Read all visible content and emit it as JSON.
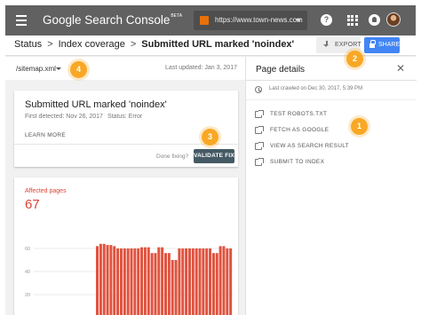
{
  "app": {
    "title": "Google Search Console",
    "badge": "BETA",
    "property_url": "https://www.town-news.com",
    "help_glyph": "?"
  },
  "breadcrumb": {
    "items": [
      "Status",
      "Index coverage",
      "Submitted URL marked 'noindex'"
    ],
    "separator": ">"
  },
  "toolbar": {
    "export_label": "EXPORT",
    "share_label": "SHARE",
    "share_color": "#4285f4"
  },
  "sitemap": {
    "selected": "/sitemap.xml",
    "last_updated": "Last updated: Jan 3, 2017"
  },
  "issue": {
    "title": "Submitted URL marked 'noindex'",
    "first_detected": "First detected: Nov 26, 2017",
    "status": "Status: Error",
    "learn_more": "LEARN MORE",
    "done_fixing": "Done fixing?",
    "validate_label": "VALIDATE FIX"
  },
  "affected": {
    "label": "Affected pages",
    "count": "67",
    "color": "#db4437"
  },
  "chart_data": {
    "type": "bar",
    "title": "",
    "xlabel": "",
    "ylabel": "",
    "yticks": [
      "60",
      "40",
      "20"
    ],
    "ylim": [
      0,
      80
    ],
    "bar_color": "#e0533f",
    "values": [
      62,
      64,
      64,
      63,
      63,
      62,
      60,
      60,
      60,
      60,
      60,
      60,
      60,
      61,
      61,
      61,
      56,
      56,
      61,
      61,
      56,
      56,
      50,
      50,
      60,
      60,
      60,
      60,
      60,
      60,
      60,
      60,
      60,
      60,
      56,
      56,
      62,
      62,
      60,
      60
    ]
  },
  "panel": {
    "title": "Page details",
    "close_glyph": "✕",
    "last_crawled": "Last crawled on Dec 30, 2017, 5:39 PM",
    "actions": [
      "TEST ROBOTS.TXT",
      "FETCH AS GOOGLE",
      "VIEW AS SEARCH RESULT",
      "SUBMIT TO INDEX"
    ]
  },
  "callouts": {
    "color": "#f9a825",
    "labels": [
      "1",
      "2",
      "3",
      "4"
    ]
  }
}
